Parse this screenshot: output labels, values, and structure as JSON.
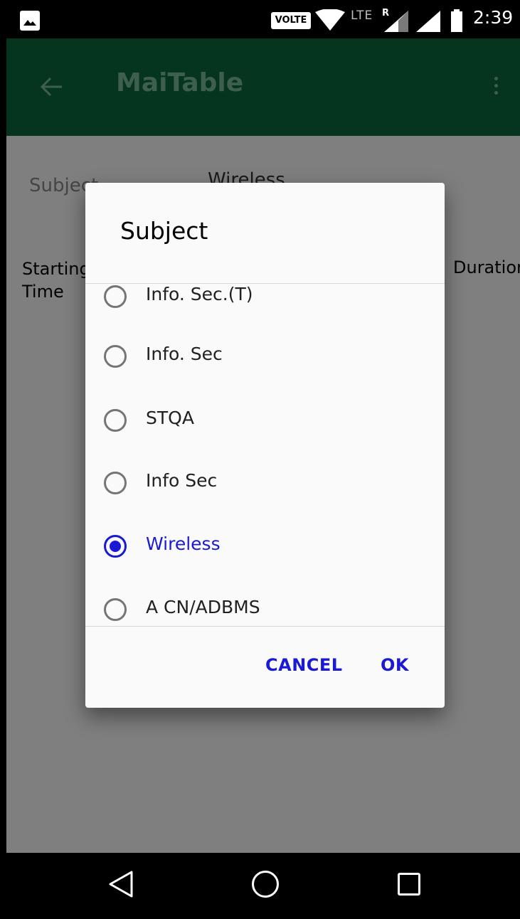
{
  "status_bar": {
    "volte": "VOLTE",
    "network": "LTE",
    "roaming": "R",
    "time": "2:39",
    "icons": [
      "image-notification-icon",
      "wifi-icon",
      "signal-icon",
      "battery-icon"
    ]
  },
  "app_bar": {
    "title": "MaiTable",
    "back_icon": "arrow-left-icon",
    "menu_icon": "more-vertical-icon"
  },
  "background": {
    "subject_label": "Subject",
    "subject_value": "Wireless",
    "starting_time_label": "Starting Time",
    "duration_label": "Duration"
  },
  "dialog": {
    "title": "Subject",
    "options": [
      {
        "label": "Info. Sec.(T)",
        "selected": false
      },
      {
        "label": "Info. Sec",
        "selected": false
      },
      {
        "label": "STQA",
        "selected": false
      },
      {
        "label": "Info Sec",
        "selected": false
      },
      {
        "label": "Wireless",
        "selected": true
      },
      {
        "label": "A CN/ADBMS",
        "selected": false
      }
    ],
    "cancel_label": "CANCEL",
    "ok_label": "OK"
  },
  "nav_bar": {
    "icons": [
      "nav-back-icon",
      "nav-home-icon",
      "nav-recents-icon"
    ]
  },
  "colors": {
    "app_bar": "#0a6a3c",
    "accent": "#1a1ad6",
    "scrim": "#808080"
  }
}
